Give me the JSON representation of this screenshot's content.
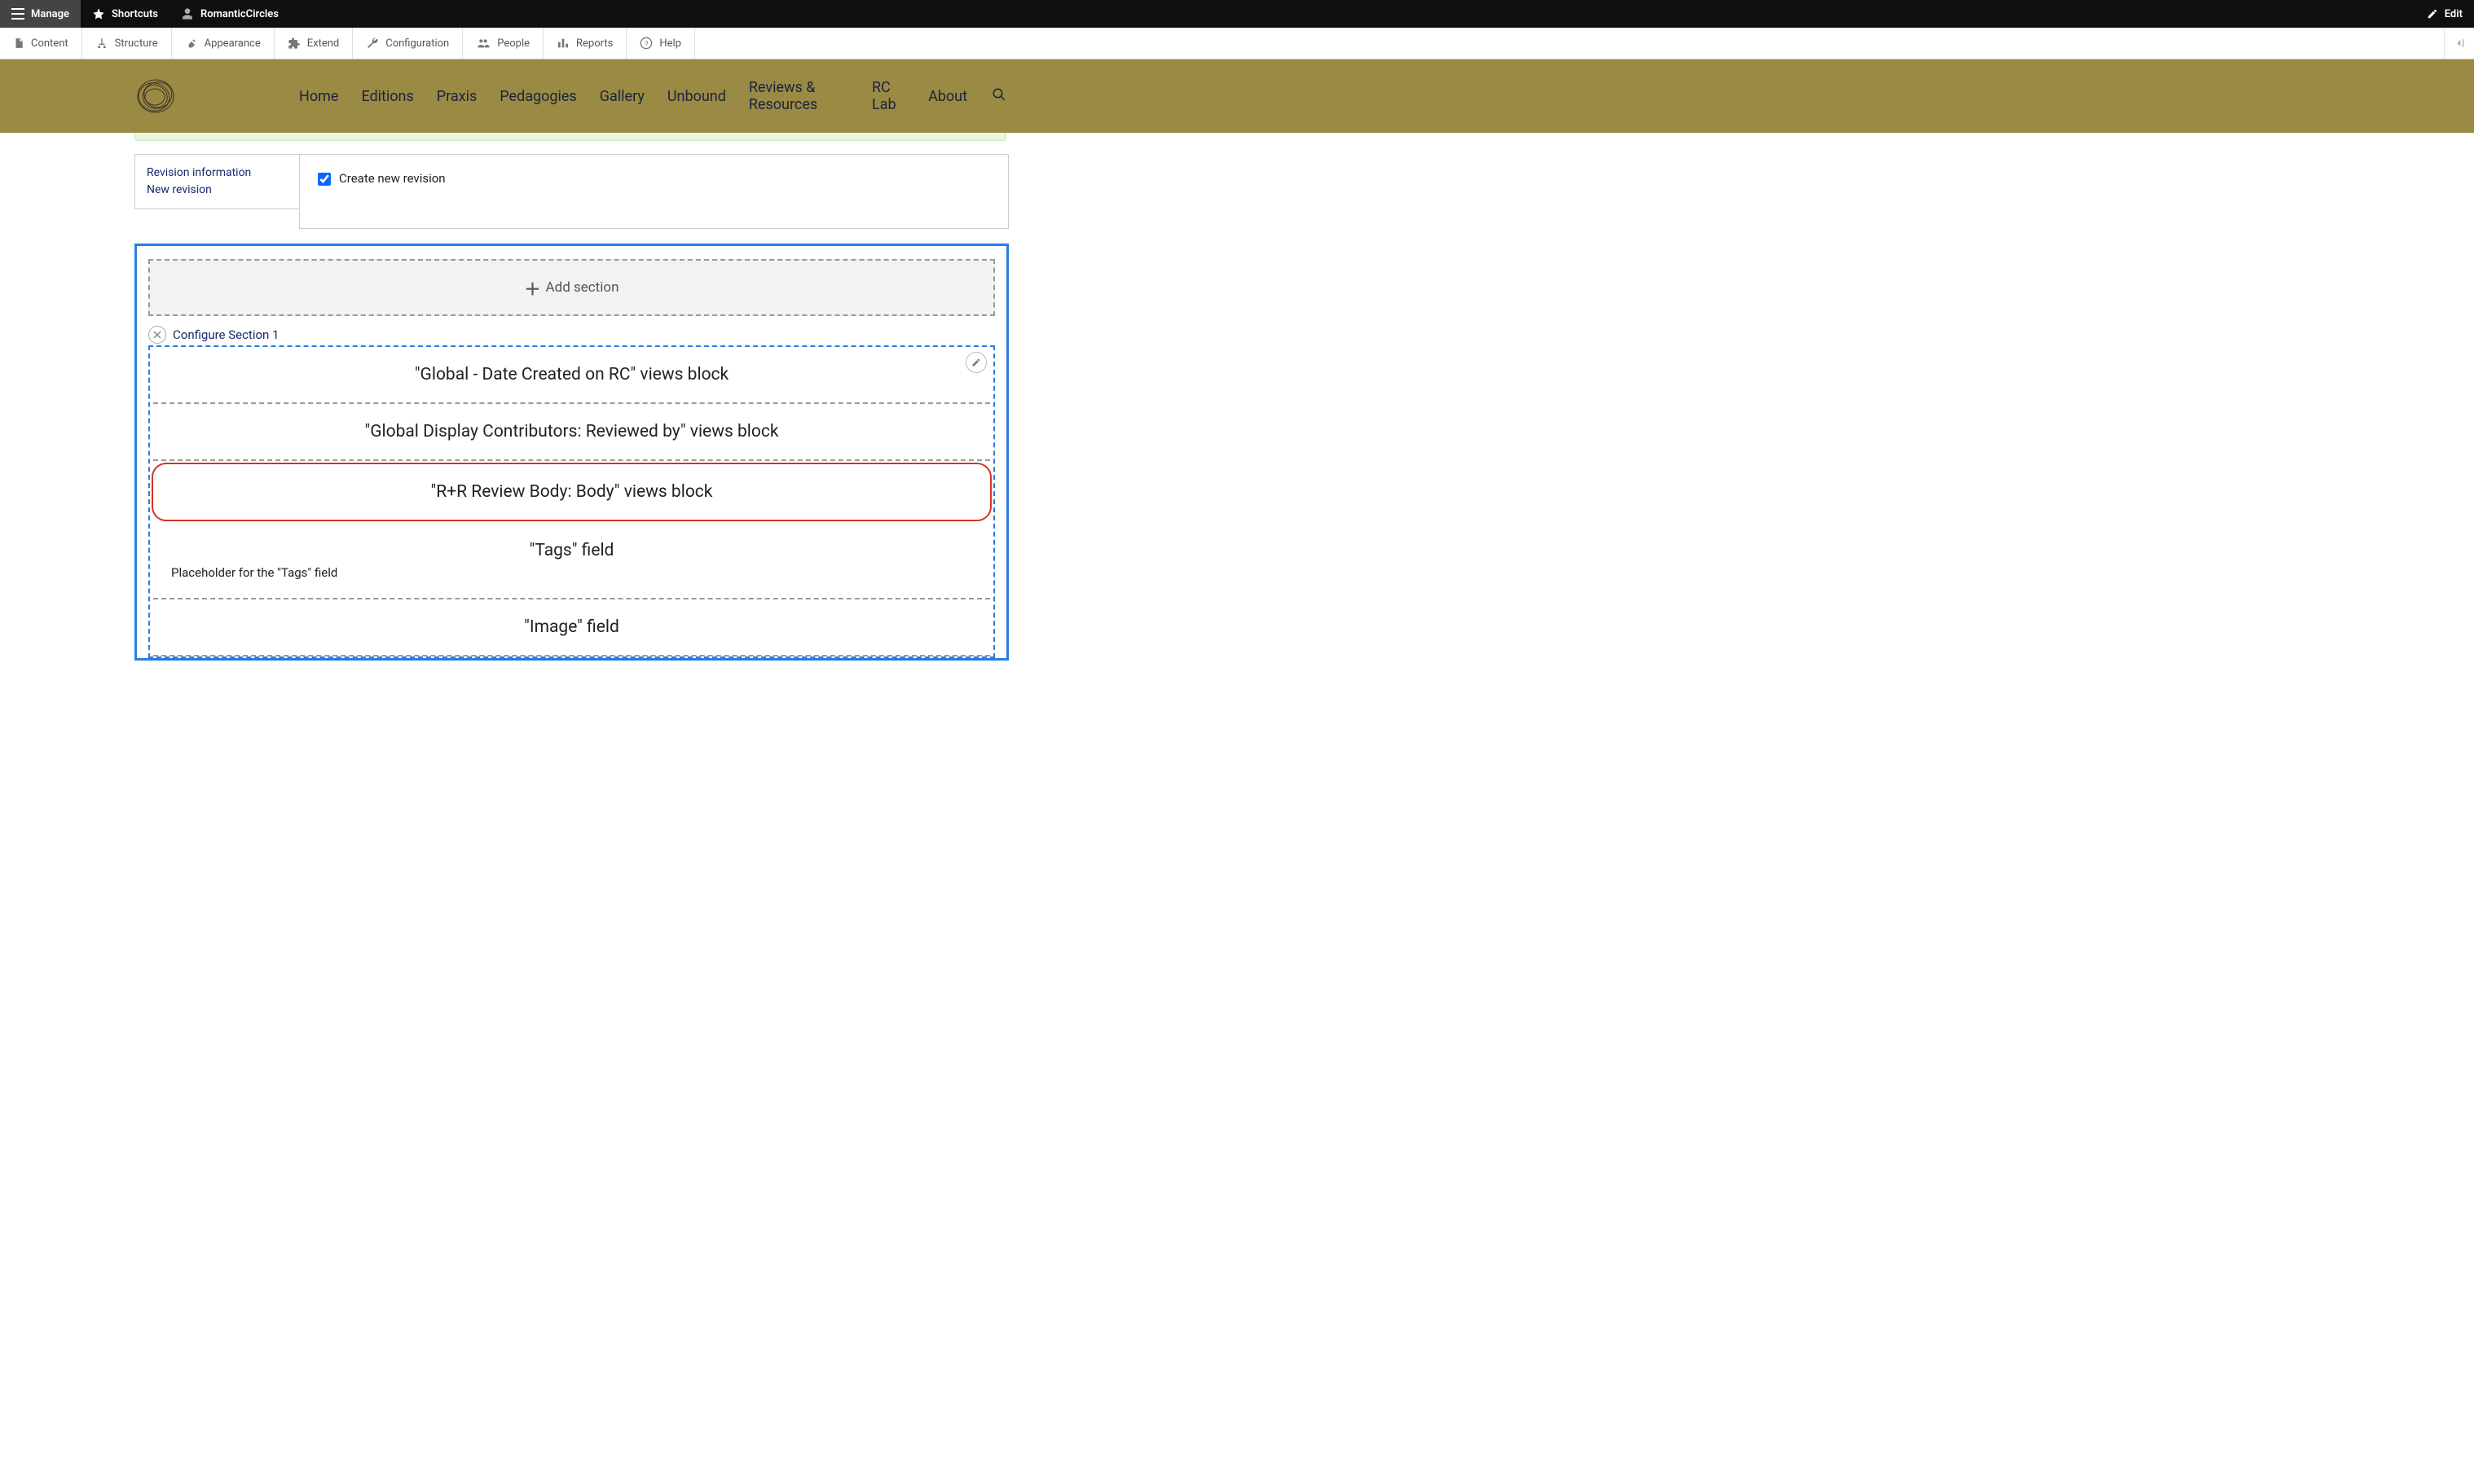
{
  "toolbar_top": {
    "manage": "Manage",
    "shortcuts": "Shortcuts",
    "user": "RomanticCircles",
    "edit": "Edit"
  },
  "toolbar_sub": {
    "content": "Content",
    "structure": "Structure",
    "appearance": "Appearance",
    "extend": "Extend",
    "configuration": "Configuration",
    "people": "People",
    "reports": "Reports",
    "help": "Help"
  },
  "nav": {
    "home": "Home",
    "editions": "Editions",
    "praxis": "Praxis",
    "pedagogies": "Pedagogies",
    "gallery": "Gallery",
    "unbound": "Unbound",
    "reviews": "Reviews & Resources",
    "rclab": "RC Lab",
    "about": "About"
  },
  "revision": {
    "tab_title": "Revision information",
    "tab_sub": "New revision",
    "checkbox_label": "Create new revision",
    "checked": true
  },
  "layout": {
    "add_section": "Add section",
    "configure_section": "Configure Section 1",
    "blocks": [
      {
        "label": "\"Global - Date Created on RC\" views block",
        "highlighted": false
      },
      {
        "label": "\"Global Display Contributors: Reviewed by\" views block",
        "highlighted": false
      },
      {
        "label": "\"R+R Review Body: Body\" views block",
        "highlighted": true
      },
      {
        "label": "\"Tags\" field",
        "highlighted": false,
        "placeholder": "Placeholder for the \"Tags\" field"
      },
      {
        "label": "\"Image\" field",
        "highlighted": false
      }
    ]
  }
}
